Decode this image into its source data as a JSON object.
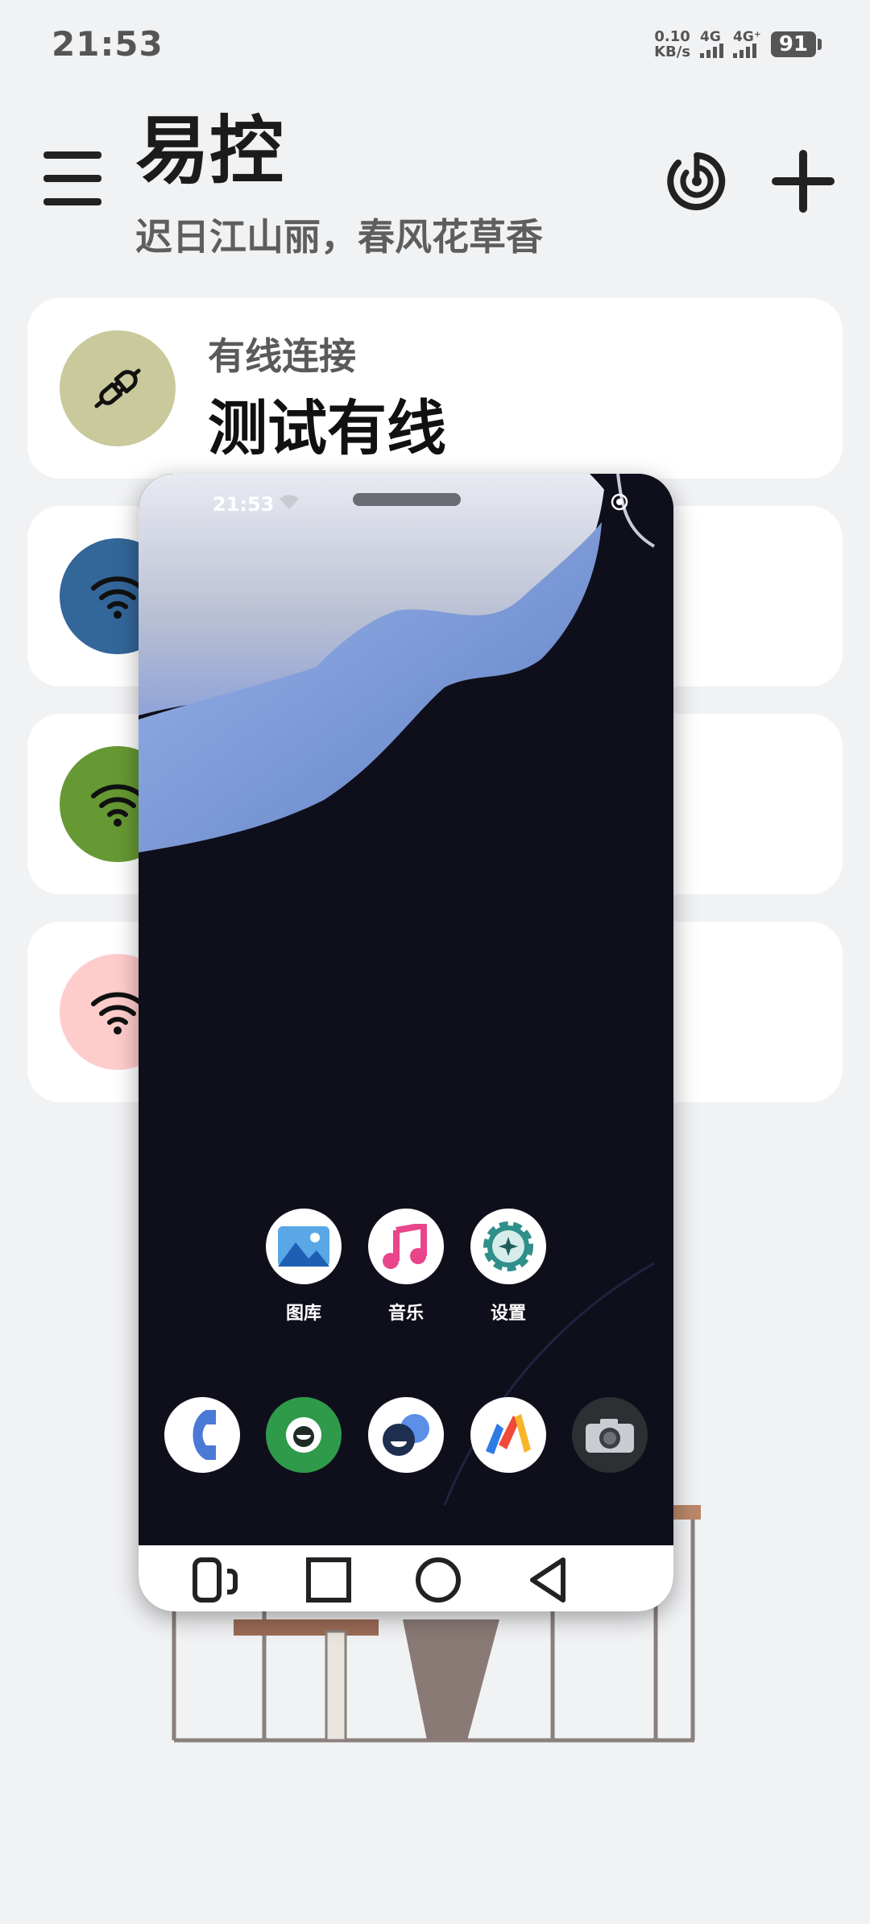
{
  "status_bar": {
    "time": "21:53",
    "net_speed_value": "0.10",
    "net_speed_unit": "KB/s",
    "sim1_label": "4G",
    "sim2_label": "4G⁺",
    "battery": "91"
  },
  "header": {
    "title": "易控",
    "subtitle": "迟日江山丽，春风花草香"
  },
  "devices": [
    {
      "type": "有线连接",
      "name": "测试有线",
      "color": "#c9c99c",
      "icon": "plug-icon"
    },
    {
      "color": "#336699",
      "icon": "wifi-icon"
    },
    {
      "color": "#669933",
      "icon": "wifi-icon"
    },
    {
      "color": "#ffcccc",
      "icon": "wifi-icon"
    }
  ],
  "mirror": {
    "time": "21:53",
    "apps": [
      {
        "label": "图库",
        "icon": "gallery-icon"
      },
      {
        "label": "音乐",
        "icon": "music-icon"
      },
      {
        "label": "设置",
        "icon": "settings-icon"
      }
    ],
    "dock": [
      {
        "icon": "phone-icon"
      },
      {
        "icon": "messages-icon"
      },
      {
        "icon": "contacts-icon"
      },
      {
        "icon": "via-browser-icon"
      },
      {
        "icon": "camera-icon"
      }
    ],
    "nav": [
      "recents-icon",
      "home-icon",
      "back-circle-icon",
      "back-icon"
    ]
  },
  "colors": {
    "background": "#f1f2f4",
    "card": "#ffffff",
    "text_primary": "#111111",
    "text_secondary": "#5a5a5a"
  }
}
